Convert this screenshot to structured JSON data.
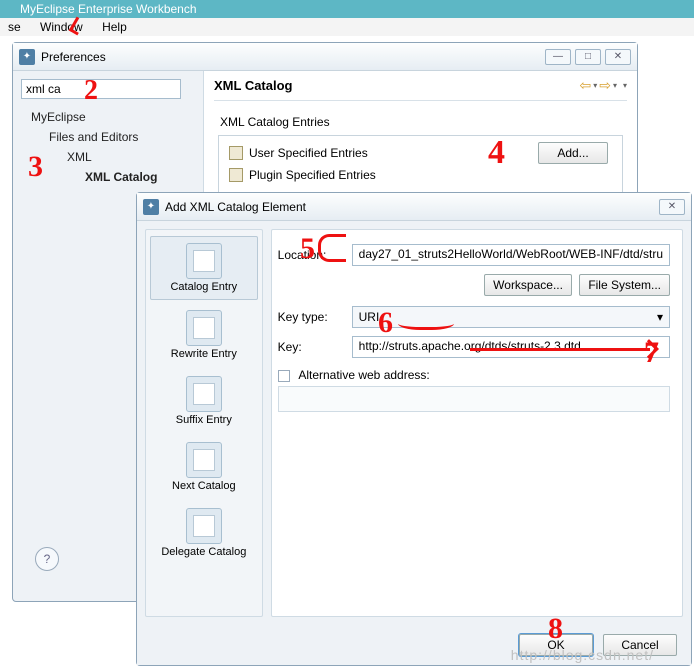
{
  "appbar_title": "MyEclipse Enterprise Workbench",
  "menu": {
    "se": "se",
    "window": "Window",
    "help": "Help"
  },
  "pref": {
    "title": "Preferences",
    "search_value": "xml ca",
    "tree": {
      "l1": "MyEclipse",
      "l2": "Files and Editors",
      "l3": "XML",
      "l4": "XML Catalog"
    },
    "heading": "XML Catalog",
    "entries_label": "XML Catalog Entries",
    "entries": {
      "user": "User Specified Entries",
      "plugin": "Plugin Specified Entries"
    },
    "add_btn": "Add...",
    "help": "?"
  },
  "addDlg": {
    "title": "Add XML Catalog Element",
    "side": {
      "catalog": "Catalog Entry",
      "rewrite": "Rewrite Entry",
      "suffix": "Suffix Entry",
      "next": "Next Catalog",
      "delegate": "Delegate Catalog"
    },
    "loc_label": "Location:",
    "loc_value": "day27_01_struts2HelloWorld/WebRoot/WEB-INF/dtd/stru",
    "workspace_btn": "Workspace...",
    "filesys_btn": "File System...",
    "keytype_label": "Key type:",
    "keytype_value": "URI",
    "key_label": "Key:",
    "key_value": "http://struts.apache.org/dtds/struts-2.3.dtd",
    "alt_label": "Alternative web address:",
    "ok": "OK",
    "cancel": "Cancel"
  },
  "annotations": {
    "n2": "2",
    "n3": "3",
    "n4": "4",
    "n5": "5",
    "n6": "6",
    "n7": "7",
    "n8": "8"
  },
  "watermark": "http://blog.csdn.net/"
}
